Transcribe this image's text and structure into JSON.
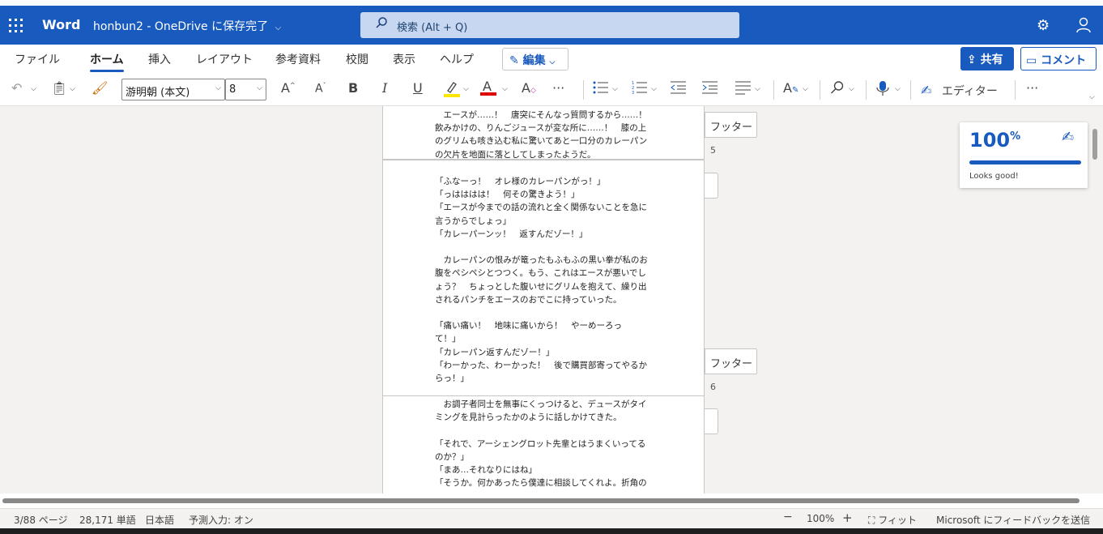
{
  "app": {
    "name": "Word",
    "document_title": "honbun2",
    "save_status": "OneDrive に保存完了",
    "search_placeholder": "検索 (Alt + Q)"
  },
  "ribbon": {
    "tabs": [
      "ファイル",
      "ホーム",
      "挿入",
      "レイアウト",
      "参考資料",
      "校閲",
      "表示",
      "ヘルプ"
    ],
    "active_tab": "ホーム",
    "edit_mode": "編集",
    "share": "共有",
    "comment": "コメント"
  },
  "toolbar": {
    "font_name": "游明朝 (本文)",
    "font_size": "8",
    "bold": "B",
    "italic": "I",
    "underline": "U",
    "font_color_glyph": "A",
    "grow_font": "A",
    "shrink_font": "A",
    "editor_label": "エディター",
    "more": "···",
    "colors": {
      "highlight": "#ffe600",
      "font_color": "#e00000"
    }
  },
  "document": {
    "pages": [
      {
        "text": "　エースが……！　唐突にそんなっ質問するから……！\n飲みかけの、りんごジュースが変な所に……！　膝の上\nのグリムも咳き込む私に驚いてあと一口分のカレーパン\nの欠片を地面に落としてしまったようだ。"
      },
      {
        "text": "「ふなーっ！　オレ様のカレーパンがっ！」\n「っはははは！　何その驚きよう！」\n「エースが今までの話の流れと全く関係ないことを急に\n言うからでしょっ」\n「カレーパーンッ！　返すんだゾー！」\n\n　カレーパンの恨みが篭ったもふもふの黒い拳が私のお\n腹をペシペシとつつく。もう、これはエースが悪いでし\nょう？　ちょっとした腹いせにグリムを抱えて、繰り出\nされるパンチをエースのおでこに持っていった。\n\n「痛い痛い！　地味に痛いから！　やーめーろっ\nて！」\n「カレーパン返すんだゾー！」\n「わーかった、わーかった！　後で購買部寄ってやるか\nらっ！」"
      },
      {
        "text": "　お調子者同士を無事にくっつけると、デュースがタイ\nミングを見計らったかのように話しかけてきた。\n\n「それで、アーシェングロット先輩とはうまくいってる\nのか？」\n「まあ…それなりにはね」\n「そうか。何かあったら僕達に相談してくれよ。折角の"
      }
    ],
    "footer_label": "フッター",
    "page_numbers": [
      "5",
      "6"
    ]
  },
  "editor_card": {
    "score": "100",
    "score_unit": "%",
    "score_fraction": 1.0,
    "message": "Looks good!"
  },
  "status_bar": {
    "page": "3/88 ページ",
    "words": "28,171 単語",
    "language": "日本語",
    "predict": "予測入力: オン",
    "zoom_minus": "−",
    "zoom": "100%",
    "zoom_plus": "+",
    "fit": "フィット",
    "feedback": "Microsoft にフィードバックを送信"
  }
}
